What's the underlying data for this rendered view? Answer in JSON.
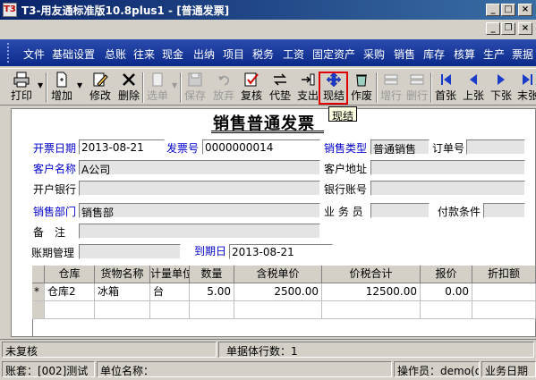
{
  "window": {
    "title": "T3-用友通标准版10.8plus1 - [普通发票]",
    "app_icon_text": "T3"
  },
  "menu": {
    "items": [
      "文件",
      "基础设置",
      "总账",
      "往来",
      "现金",
      "出纳",
      "项目",
      "税务",
      "工资",
      "固定资产",
      "采购",
      "销售",
      "库存",
      "核算",
      "生产",
      "票据"
    ]
  },
  "toolbar": {
    "print": "打印",
    "add": "增加",
    "edit": "修改",
    "delete": "删除",
    "select": "选单",
    "save": "保存",
    "abandon": "放弃",
    "review": "复核",
    "advance": "代垫",
    "expense": "支出",
    "settle": "现结",
    "void": "作废",
    "add_row": "增行",
    "delete_row": "删行",
    "first": "首张",
    "prev": "上张",
    "next": "下张",
    "last": "末张"
  },
  "tooltip": "现结",
  "document": {
    "title": "销售普通发票",
    "labels": {
      "invoice_date": "开票日期",
      "invoice_no": "发票号",
      "sales_type": "销售类型",
      "order_no": "订单号",
      "customer": "客户名称",
      "customer_address": "客户地址",
      "bank": "开户银行",
      "bank_account": "银行账号",
      "department": "销售部门",
      "salesperson": "业 务 员",
      "payment_terms": "付款条件",
      "remark": "备　注",
      "period_mgmt": "账期管理",
      "due_date": "到期日"
    },
    "values": {
      "invoice_date": "2013-08-21",
      "invoice_no": "0000000014",
      "sales_type": "普通销售",
      "order_no": "",
      "customer": "A公司",
      "customer_address": "",
      "bank": "",
      "bank_account": "",
      "department": "销售部",
      "salesperson": "",
      "payment_terms": "",
      "remark": "",
      "period_mgmt": "",
      "due_date": "2013-08-21"
    }
  },
  "grid": {
    "columns": [
      "仓库",
      "货物名称",
      "计量单位",
      "数量",
      "含税单价",
      "价税合计",
      "报价",
      "折扣额"
    ],
    "rows": [
      {
        "marker": "*",
        "warehouse": "仓库2",
        "goods": "冰箱",
        "unit": "台",
        "qty": "5.00",
        "price": "2500.00",
        "total": "12500.00",
        "quote": "0.00",
        "discount": ""
      }
    ]
  },
  "status": {
    "review_state": "未复核",
    "row_count": "单据体行数：1",
    "account": "账套：[002]测试",
    "company": "单位名称：",
    "operator": "操作员：demo(de",
    "business_date": "业务日期"
  }
}
